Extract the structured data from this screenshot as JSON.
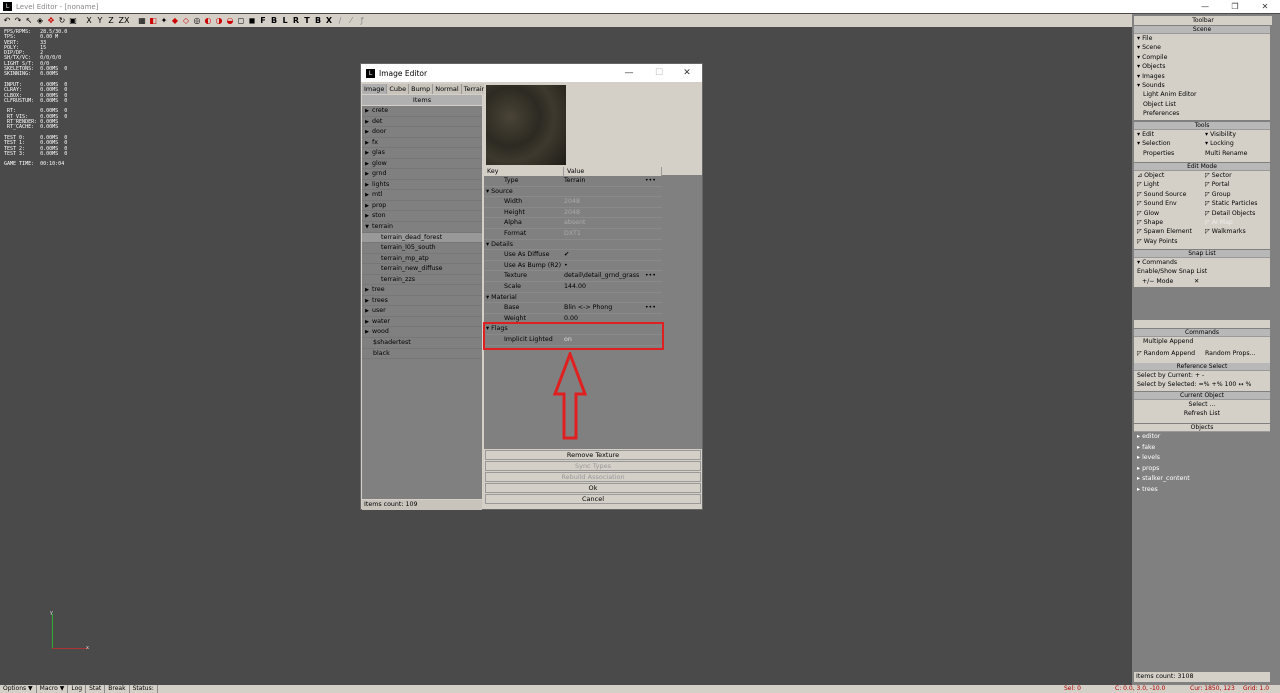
{
  "app": {
    "title": "Level Editor - [noname]",
    "min": "—",
    "restore": "❐",
    "close": "✕"
  },
  "toolbar": {
    "icons": [
      {
        "name": "undo-icon",
        "glyph": "↶",
        "red": false
      },
      {
        "name": "redo-icon",
        "glyph": "↷",
        "red": false
      },
      {
        "name": "select-icon",
        "glyph": "↖",
        "red": false
      },
      {
        "name": "camera-icon",
        "glyph": "◈",
        "red": false
      },
      {
        "name": "move-icon",
        "glyph": "✥",
        "red": true
      },
      {
        "name": "rotate-icon",
        "glyph": "↻",
        "red": false
      },
      {
        "name": "scale-icon",
        "glyph": "▣",
        "red": false
      },
      {
        "name": "axis-x-button",
        "glyph": "X",
        "red": false
      },
      {
        "name": "axis-y-button",
        "glyph": "Y",
        "red": false
      },
      {
        "name": "axis-z-button",
        "glyph": "Z",
        "red": false
      },
      {
        "name": "axis-zx-button",
        "glyph": "ZX",
        "red": false
      },
      {
        "name": "grid-icon",
        "glyph": "▦",
        "red": false
      },
      {
        "name": "snap-icon",
        "glyph": "◧",
        "red": true
      },
      {
        "name": "snap-vertex-icon",
        "glyph": "✦",
        "red": false
      },
      {
        "name": "snap-object-icon",
        "glyph": "◆",
        "red": true
      },
      {
        "name": "snap-move-icon",
        "glyph": "◇",
        "red": true
      },
      {
        "name": "snap-rotate-icon",
        "glyph": "◎",
        "red": false
      },
      {
        "name": "snap-scale-icon",
        "glyph": "◐",
        "red": true
      },
      {
        "name": "snap-normal-icon",
        "glyph": "◑",
        "red": true
      },
      {
        "name": "snap-surface-icon",
        "glyph": "◒",
        "red": true
      },
      {
        "name": "zoom-extent-icon",
        "glyph": "◻",
        "red": false
      },
      {
        "name": "zoom-selected-icon",
        "glyph": "◼",
        "red": false
      }
    ],
    "views": [
      "F",
      "B",
      "L",
      "R",
      "T",
      "B",
      "X"
    ],
    "extra": [
      "∕",
      "⁄",
      "ƒ"
    ]
  },
  "stats": "FPS/RPMS:   28.5/30.0\nTPS:        0.00 M\nVERT:       33\nPOLY:       15\nDIP/DP:     2\nSH/TX/VC:   0/0/0/0\nLIGHT S/T:  0/0\nSKELETONS:  0.00MS  0\nSKINNING:   0.00MS\n\nINPUT:      0.00MS  0\nCLRAY:      0.00MS  0\nCLBOX:      0.00MS  0\nCLFRUSTUM:  0.00MS  0\n\n RT:        0.00MS  0\n RT_VIS:    0.00MS  0\n RT_RENDER: 0.00MS\n RT_CACHE:  0.00MS\n\nTEST 0:     0.00MS  0\nTEST 1:     0.00MS  0\nTEST 2:     0.00MS  0\nTEST 3:     0.00MS  0\n\nGAME TIME:  00:10:04",
  "axes": {
    "y": "y",
    "x": "x"
  },
  "status": {
    "left": [
      "Options ▼",
      "Macro ▼",
      "Log",
      "Stat",
      "Break",
      "Status:"
    ],
    "sel": "Sel: 0",
    "coord": "C: 0.0, 3.0, -10.0",
    "cur": "Cur: 1850, 123",
    "grid": "Grid: 1.0"
  },
  "panel": {
    "title": "Toolbar",
    "scene": {
      "header": "Scene",
      "items": [
        "▾ File",
        "▾ Scene",
        "▾ Compile",
        "▾ Objects",
        "▾ Images",
        "▾ Sounds"
      ],
      "sub": [
        "Light Anim Editor",
        "Object List",
        "Preferences"
      ]
    },
    "tools": {
      "header": "Tools",
      "rows": [
        [
          "▾ Edit",
          "▾ Visibility"
        ],
        [
          "▾ Selection",
          "▾ Locking"
        ],
        [
          "Properties",
          "Multi Rename"
        ]
      ]
    },
    "editmode": {
      "header": "Edit Mode",
      "rows": [
        [
          "⊿ Object",
          "◸ Sector"
        ],
        [
          "◸ Light",
          "◸ Portal"
        ],
        [
          "◸ Sound Source",
          "◸ Group"
        ],
        [
          "◸ Sound Env",
          "◸ Static Particles"
        ],
        [
          "◸ Glow",
          "◸ Detail Objects"
        ],
        [
          "◸ Shape",
          "◸ AI Map"
        ],
        [
          "◸ Spawn Element",
          "◸ Walkmarks"
        ],
        [
          "◸ Way Points",
          ""
        ]
      ]
    },
    "snaplist": {
      "header": "Snap List",
      "items": [
        "▾ Commands",
        "Enable/Show Snap List"
      ],
      "mode": "+/− Mode",
      "close": "✕"
    },
    "commands": {
      "header": "Commands",
      "items": [
        "Multiple Append"
      ],
      "row": [
        "◸ Random Append",
        "Random Props..."
      ]
    },
    "refsel": {
      "header": "Reference Select",
      "cur": "Select by Current:     +      -",
      "sel": "Select by Selected:  =%   +%   100 ↔ %"
    },
    "curobj": {
      "header": "Current Object",
      "items": [
        "Select ...",
        "Refresh List"
      ]
    },
    "objects": {
      "header": "Objects",
      "items": [
        "editor",
        "fake",
        "levels",
        "props",
        "stalker_content",
        "trees"
      ]
    },
    "count": "Items count: 3108"
  },
  "editor": {
    "title": "Image Editor",
    "tabs": [
      "Image",
      "Cube",
      "Bump",
      "Normal",
      "Terrain"
    ],
    "items_header": "Items",
    "items": [
      {
        "label": "crete",
        "type": "folder"
      },
      {
        "label": "det",
        "type": "folder"
      },
      {
        "label": "door",
        "type": "folder"
      },
      {
        "label": "fx",
        "type": "folder"
      },
      {
        "label": "glas",
        "type": "folder"
      },
      {
        "label": "glow",
        "type": "folder"
      },
      {
        "label": "grnd",
        "type": "folder"
      },
      {
        "label": "lights",
        "type": "folder"
      },
      {
        "label": "mtl",
        "type": "folder"
      },
      {
        "label": "prop",
        "type": "folder"
      },
      {
        "label": "ston",
        "type": "folder"
      },
      {
        "label": "terrain",
        "type": "open"
      },
      {
        "label": "terrain_dead_forest",
        "type": "child-sel"
      },
      {
        "label": "terrain_l05_south",
        "type": "child"
      },
      {
        "label": "terrain_mp_atp",
        "type": "child"
      },
      {
        "label": "terrain_new_diffuse",
        "type": "child"
      },
      {
        "label": "terrain_zzs",
        "type": "child"
      },
      {
        "label": "tree",
        "type": "folder"
      },
      {
        "label": "trees",
        "type": "folder"
      },
      {
        "label": "user",
        "type": "folder"
      },
      {
        "label": "water",
        "type": "folder"
      },
      {
        "label": "wood",
        "type": "folder"
      },
      {
        "label": "$shadertest",
        "type": "plain"
      },
      {
        "label": "black",
        "type": "plain"
      }
    ],
    "count": "Items count: 109",
    "props_header": {
      "key": "Key",
      "value": "Value"
    },
    "props": [
      {
        "k": "Type",
        "v": "Terrain",
        "lvl": 1,
        "dots": "•••",
        "muted": false
      },
      {
        "k": "▾ Source",
        "v": "",
        "lvl": 0,
        "dots": "",
        "muted": false
      },
      {
        "k": "Width",
        "v": "2048",
        "lvl": 1,
        "dots": "",
        "muted": true
      },
      {
        "k": "Height",
        "v": "2048",
        "lvl": 1,
        "dots": "",
        "muted": true
      },
      {
        "k": "Alpha",
        "v": "absent",
        "lvl": 1,
        "dots": "",
        "muted": true
      },
      {
        "k": "Format",
        "v": "DXT1",
        "lvl": 1,
        "dots": "",
        "muted": true
      },
      {
        "k": "▾ Details",
        "v": "",
        "lvl": 0,
        "dots": "",
        "muted": false
      },
      {
        "k": "Use As Diffuse",
        "v": "✔",
        "lvl": 1,
        "dots": "",
        "muted": false
      },
      {
        "k": "Use As Bump (R2)",
        "v": "•",
        "lvl": 1,
        "dots": "",
        "muted": false
      },
      {
        "k": "Texture",
        "v": "detail\\detail_grnd_grass",
        "lvl": 1,
        "dots": "•••",
        "muted": false
      },
      {
        "k": "Scale",
        "v": "144.00",
        "lvl": 1,
        "dots": "",
        "muted": false
      },
      {
        "k": "▾ Material",
        "v": "",
        "lvl": 0,
        "dots": "",
        "muted": false
      },
      {
        "k": "Base",
        "v": "Blin <-> Phong",
        "lvl": 1,
        "dots": "•••",
        "muted": false
      },
      {
        "k": "Weight",
        "v": "0.00",
        "lvl": 1,
        "dots": "",
        "muted": false
      },
      {
        "k": "▾ Flags",
        "v": "",
        "lvl": 0,
        "dots": "",
        "muted": false
      },
      {
        "k": "Implicit Lighted",
        "v": "on",
        "lvl": 1,
        "dots": "",
        "muted": true
      }
    ],
    "buttons": [
      {
        "label": "Remove Texture",
        "disabled": false
      },
      {
        "label": "Sync Types",
        "disabled": true
      },
      {
        "label": "Rebuild Association",
        "disabled": true
      },
      {
        "label": "Ok",
        "disabled": false
      },
      {
        "label": "Cancel",
        "disabled": false
      }
    ]
  }
}
